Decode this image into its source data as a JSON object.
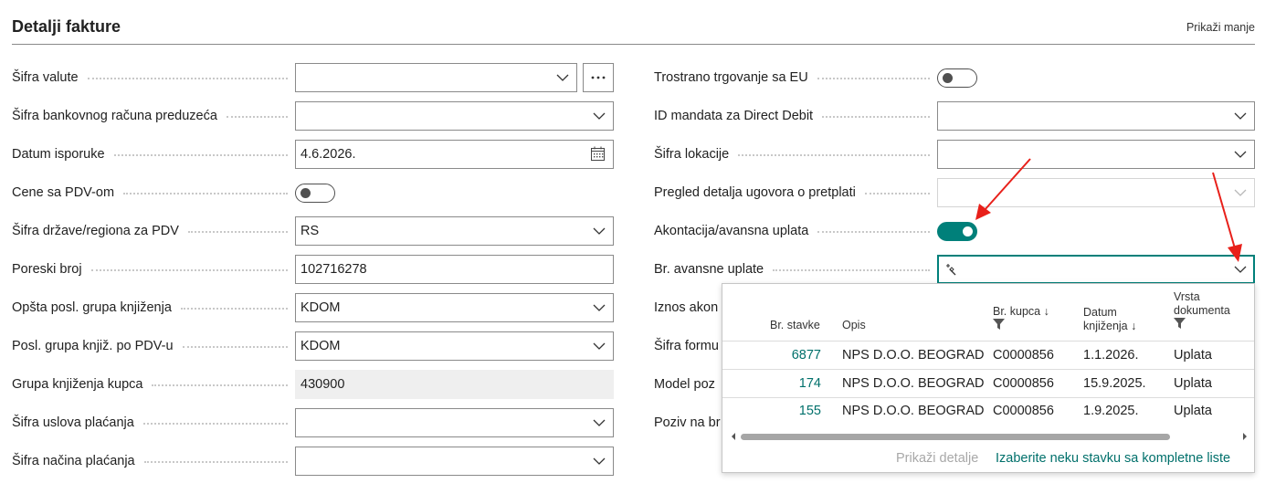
{
  "header": {
    "title": "Detalji fakture",
    "show_less": "Prikaži manje"
  },
  "left_fields": [
    {
      "label": "Šifra valute",
      "value": "",
      "type": "dropdown-lookup"
    },
    {
      "label": "Šifra bankovnog računa preduzeća",
      "value": "",
      "type": "dropdown"
    },
    {
      "label": "Datum isporuke",
      "value": "4.6.2026.",
      "type": "date"
    },
    {
      "label": "Cene sa PDV-om",
      "value": "off",
      "type": "toggle"
    },
    {
      "label": "Šifra države/regiona za PDV",
      "value": "RS",
      "type": "dropdown"
    },
    {
      "label": "Poreski broj",
      "value": "102716278",
      "type": "text"
    },
    {
      "label": "Opšta posl. grupa knjiženja",
      "value": "KDOM",
      "type": "dropdown"
    },
    {
      "label": "Posl. grupa knjiž. po PDV-u",
      "value": "KDOM",
      "type": "dropdown"
    },
    {
      "label": "Grupa knjiženja kupca",
      "value": "430900",
      "type": "readonly"
    },
    {
      "label": "Šifra uslova plaćanja",
      "value": "",
      "type": "dropdown"
    },
    {
      "label": "Šifra načina plaćanja",
      "value": "",
      "type": "dropdown"
    }
  ],
  "right_fields": [
    {
      "label": "Trostrano trgovanje sa EU",
      "value": "off",
      "type": "toggle"
    },
    {
      "label": "ID mandata za Direct Debit",
      "value": "",
      "type": "dropdown"
    },
    {
      "label": "Šifra lokacije",
      "value": "",
      "type": "dropdown"
    },
    {
      "label": "Pregled detalja ugovora o pretplati",
      "value": "",
      "type": "dropdown-disabled"
    },
    {
      "label": "Akontacija/avansna uplata",
      "value": "on",
      "type": "toggle"
    },
    {
      "label": "Br. avansne uplate",
      "value": "",
      "type": "dropdown-focus"
    },
    {
      "label": "Iznos akon",
      "value": "",
      "type": "hidden"
    },
    {
      "label": "Šifra formu",
      "value": "",
      "type": "hidden"
    },
    {
      "label": "Model poz",
      "value": "",
      "type": "hidden"
    },
    {
      "label": "Poziv na br",
      "value": "",
      "type": "hidden"
    }
  ],
  "lookup": {
    "columns": {
      "line_no": "Br. stavke",
      "description": "Opis",
      "customer_no": "Br. kupca",
      "posting_date_1": "Datum",
      "posting_date_2": "knjiženja",
      "doc_type_1": "Vrsta",
      "doc_type_2": "dokumenta",
      "sort_arrow": "↓"
    },
    "rows": [
      {
        "line_no": "6877",
        "description": "NPS D.O.O. BEOGRAD",
        "customer_no": "C0000856",
        "posting_date": "1.1.2026.",
        "doc_type": "Uplata"
      },
      {
        "line_no": "174",
        "description": "NPS D.O.O. BEOGRAD",
        "customer_no": "C0000856",
        "posting_date": "15.9.2025.",
        "doc_type": "Uplata"
      },
      {
        "line_no": "155",
        "description": "NPS D.O.O. BEOGRAD",
        "customer_no": "C0000856",
        "posting_date": "1.9.2025.",
        "doc_type": "Uplata"
      }
    ],
    "show_details": "Prikaži detalje",
    "select_from_full_list": "Izaberite neku stavku sa kompletne liste"
  },
  "colors": {
    "accent": "#00807a",
    "link": "#00706b",
    "annotation_arrow": "#e8201a",
    "border": "#8a8a8a"
  }
}
